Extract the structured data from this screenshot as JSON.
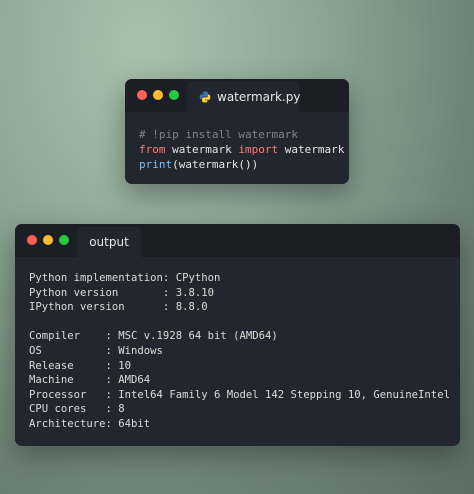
{
  "code_window": {
    "tab_label": "watermark.py",
    "lines": [
      {
        "parts": [
          {
            "cls": "comment",
            "text": "# !pip install watermark"
          }
        ]
      },
      {
        "parts": [
          {
            "cls": "kw",
            "text": "from"
          },
          {
            "cls": "ident",
            "text": " watermark "
          },
          {
            "cls": "kw",
            "text": "import"
          },
          {
            "cls": "ident",
            "text": " watermark"
          }
        ]
      },
      {
        "parts": [
          {
            "cls": "fn",
            "text": "print"
          },
          {
            "cls": "ident",
            "text": "(watermark())"
          }
        ]
      }
    ]
  },
  "output_window": {
    "tab_label": "output",
    "lines": [
      "Python implementation: CPython",
      "Python version       : 3.8.10",
      "IPython version      : 8.8.0",
      "",
      "Compiler    : MSC v.1928 64 bit (AMD64)",
      "OS          : Windows",
      "Release     : 10",
      "Machine     : AMD64",
      "Processor   : Intel64 Family 6 Model 142 Stepping 10, GenuineIntel",
      "CPU cores   : 8",
      "Architecture: 64bit"
    ]
  },
  "icons": {
    "code_tab_icon": "python-logo-icon",
    "window_controls": [
      "close-dot-icon",
      "minimize-dot-icon",
      "maximize-dot-icon"
    ]
  },
  "colors": {
    "background": "#8fa896",
    "window_bg": "#22262e",
    "titlebar_bg": "#1b1e25",
    "keyword": "#ff7b72",
    "function": "#79c0ff",
    "comment": "#7d8590",
    "close": "#ff5f57",
    "minimize": "#febc2e",
    "maximize": "#28c840"
  }
}
